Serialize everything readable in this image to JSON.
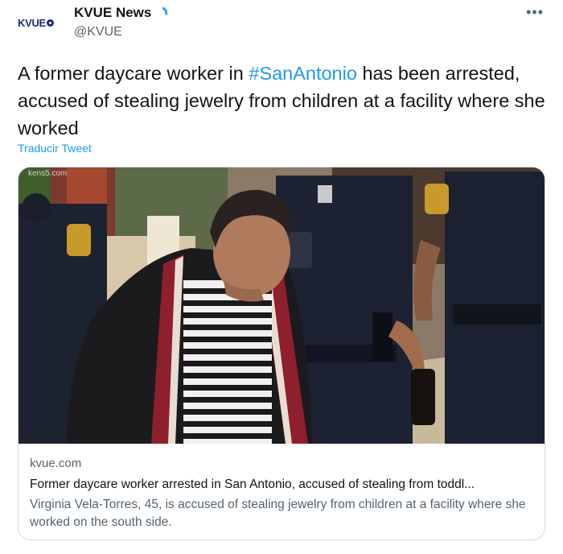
{
  "account": {
    "logo_text": "KVUE",
    "display_name": "KVUE News",
    "handle": "@KVUE",
    "more_icon": "more-dots-icon",
    "verified_icon": "verified-badge-icon"
  },
  "tweet": {
    "text_before": "A former daycare worker in ",
    "hashtag": "#SanAntonio",
    "text_after": " has been arrested, accused of stealing jewelry from children at a facility where she worked",
    "translate_label": "Traducir Tweet"
  },
  "card": {
    "watermark": "kens5.com",
    "domain": "kvue.com",
    "title": "Former daycare worker arrested in San Antonio, accused of stealing from toddl...",
    "description": "Virginia Vela-Torres, 45, is accused of stealing jewelry from children at a facility where she worked on the south side."
  },
  "colors": {
    "link": "#1d9bf0",
    "text": "#0f1419",
    "secondary": "#536471",
    "verified": "#1d9bf0",
    "logo": "#1b2a78"
  }
}
